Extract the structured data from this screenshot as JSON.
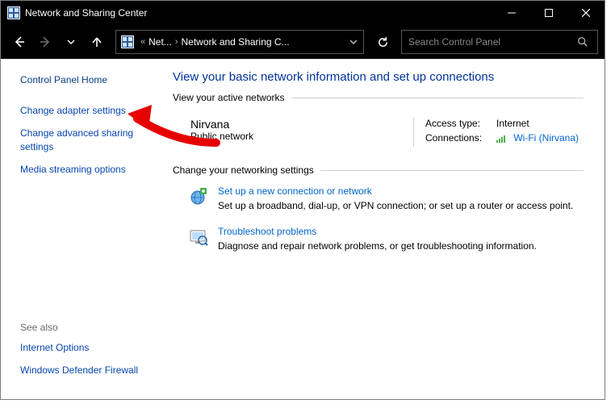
{
  "titlebar": {
    "title": "Network and Sharing Center"
  },
  "nav": {
    "breadcrumb_prefix": "«",
    "breadcrumb_item1": "Net...",
    "breadcrumb_item2": "Network and Sharing C...",
    "search_placeholder": "Search Control Panel"
  },
  "sidebar": {
    "home": "Control Panel Home",
    "item0": "Change adapter settings",
    "item1": "Change advanced sharing settings",
    "item2": "Media streaming options",
    "see_also_label": "See also",
    "see0": "Internet Options",
    "see1": "Windows Defender Firewall"
  },
  "main": {
    "page_title": "View your basic network information and set up connections",
    "active_label": "View your active networks",
    "network_name": "Nirvana",
    "network_type": "Public network",
    "access_key": "Access type:",
    "access_val": "Internet",
    "conn_key": "Connections:",
    "conn_val": "Wi-Fi (Nirvana)",
    "change_label": "Change your networking settings",
    "opt0_title": "Set up a new connection or network",
    "opt0_desc": "Set up a broadband, dial-up, or VPN connection; or set up a router or access point.",
    "opt1_title": "Troubleshoot problems",
    "opt1_desc": "Diagnose and repair network problems, or get troubleshooting information."
  }
}
